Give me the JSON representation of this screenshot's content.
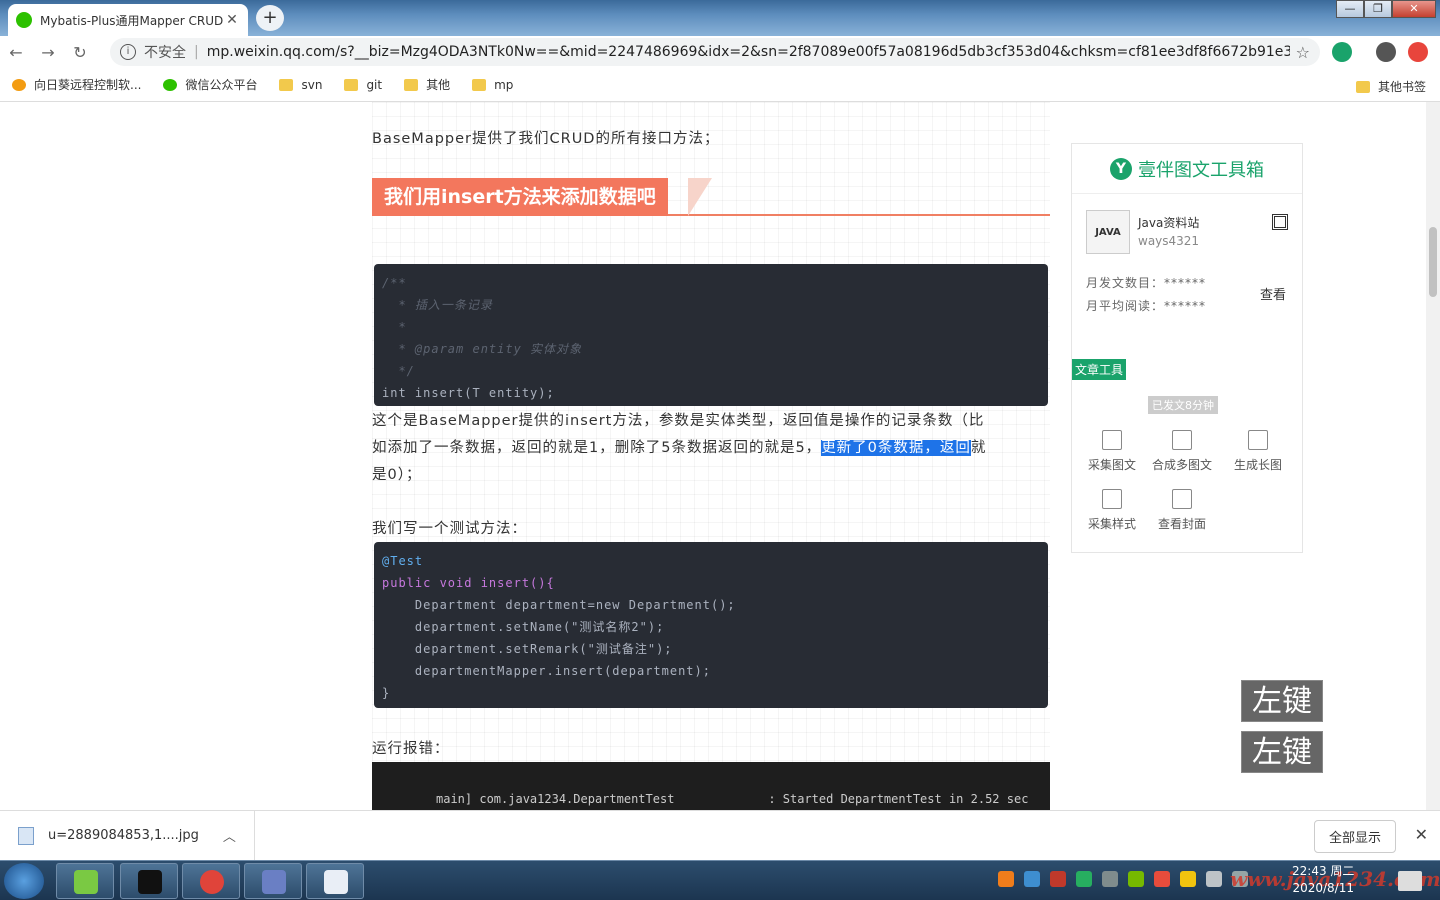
{
  "window": {
    "tab_title": "Mybatis-Plus通用Mapper CRUD",
    "close_tab": "✕",
    "new_tab": "+",
    "min": "—",
    "max": "❐",
    "close": "✕"
  },
  "address": {
    "insecure": "不安全",
    "url": "mp.weixin.qq.com/s?__biz=Mzg4ODA3NTk0Nw==&mid=2247486969&idx=2&sn=2f87089e00f57a08196d5db3cf353d04&chksm=cf81ee3df8f6672b91e3f155..."
  },
  "bookmarks": {
    "items": [
      "向日葵远程控制软...",
      "微信公众平台",
      "svn",
      "git",
      "其他",
      "mp"
    ],
    "other": "其他书签"
  },
  "article": {
    "intro": "BaseMapper提供了我们CRUD的所有接口方法；",
    "heading": "我们用insert方法来添加数据吧",
    "code1": [
      "/**",
      "  * 插入一条记录",
      "  *",
      "  * @param entity 实体对象",
      "  */",
      "int insert(T entity);"
    ],
    "para1": "这个是BaseMapper提供的insert方法，参数是实体类型，返回值是操作的记录条数（比",
    "para2_a": "如添加了一条数据，返回的就是1，删除了5条数据返回的就是5，",
    "para2_hl": "更新了0条数据，返回",
    "para2_b": "就",
    "para3": "是0）；",
    "test_intro": "我们写一个测试方法：",
    "code2": [
      "@Test",
      "public void insert(){",
      "    Department department=new Department();",
      "    department.setName(\"测试名称2\");",
      "    department.setRemark(\"测试备注\");",
      "    departmentMapper.insert(department);",
      "}"
    ],
    "run_log": "运行报错：",
    "terminal": "main] com.java1234.DepartmentTest             : Started DepartmentTest in 2.52 sec"
  },
  "panel": {
    "title": "壹伴图文工具箱",
    "logo": "Y",
    "account_name": "Java资料站",
    "account_id": "ways4321",
    "account_logo": "JAVA",
    "monthly_posts": "月发文数目：******",
    "monthly_reads": "月平均阅读：******",
    "look": "查看",
    "tool_tag": "文章工具",
    "published": "已发文8分钟",
    "tools": [
      "采集图文",
      "合成多图文",
      "生成长图",
      "采集样式",
      "查看封面"
    ]
  },
  "floats": [
    "左键",
    "左键"
  ],
  "download": {
    "file": "u=2889084853,1....jpg",
    "show_all": "全部显示"
  },
  "taskbar": {
    "time": "22:43 周二",
    "date": "2020/8/11",
    "watermark": "www.java1234.com"
  }
}
